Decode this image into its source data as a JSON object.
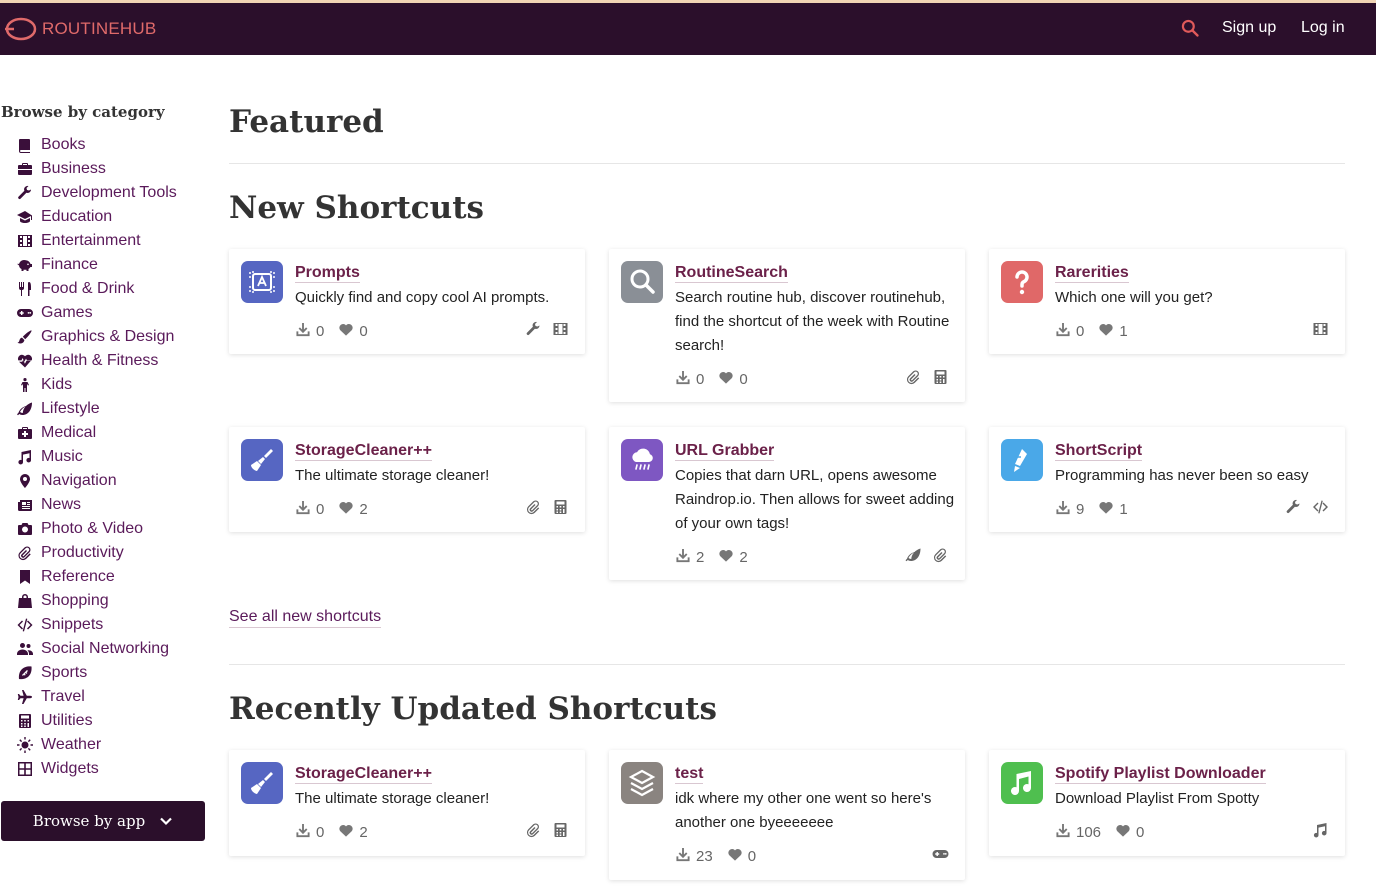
{
  "navbar": {
    "logo_text": "ROUTINEHUB",
    "signup": "Sign up",
    "login": "Log in"
  },
  "sidebar": {
    "title": "Browse by category",
    "categories": [
      "Books",
      "Business",
      "Development Tools",
      "Education",
      "Entertainment",
      "Finance",
      "Food & Drink",
      "Games",
      "Graphics & Design",
      "Health & Fitness",
      "Kids",
      "Lifestyle",
      "Medical",
      "Music",
      "Navigation",
      "News",
      "Photo & Video",
      "Productivity",
      "Reference",
      "Shopping",
      "Snippets",
      "Social Networking",
      "Sports",
      "Travel",
      "Utilities",
      "Weather",
      "Widgets"
    ],
    "browse_app": "Browse by app"
  },
  "featured": {
    "title": "Featured"
  },
  "new_shortcuts": {
    "title": "New Shortcuts",
    "see_all": "See all new shortcuts",
    "cards": [
      {
        "name": "Prompts",
        "desc": "Quickly find and copy cool AI prompts.",
        "downloads": "0",
        "hearts": "0",
        "icon_color": "#5666c2",
        "icon": "ai-prompt-icon",
        "cats": [
          "wrench-icon",
          "film-icon"
        ]
      },
      {
        "name": "RoutineSearch",
        "desc": "Search routine hub, discover routinehub, find the shortcut of the week with Routine search!",
        "downloads": "0",
        "hearts": "0",
        "icon_color": "#8a8f96",
        "icon": "magnifier-icon",
        "cats": [
          "paperclip-icon",
          "calculator-icon"
        ]
      },
      {
        "name": "Rarerities",
        "desc": "Which one will you get?",
        "downloads": "0",
        "hearts": "1",
        "icon_color": "#e06868",
        "icon": "question-mark-icon",
        "cats": [
          "film-icon"
        ]
      },
      {
        "name": "StorageCleaner++",
        "desc": "The ultimate storage cleaner!",
        "downloads": "0",
        "hearts": "2",
        "icon_color": "#5666c2",
        "icon": "broom-icon",
        "cats": [
          "paperclip-icon",
          "calculator-icon"
        ]
      },
      {
        "name": "URL Grabber",
        "desc": "Copies that darn URL, opens awesome Raindrop.io. Then allows for sweet adding of your own tags!",
        "downloads": "2",
        "hearts": "2",
        "icon_color": "#7e57c2",
        "icon": "rain-cloud-icon",
        "cats": [
          "leaf-icon",
          "paperclip-icon"
        ]
      },
      {
        "name": "ShortScript",
        "desc": "Programming has never been so easy",
        "downloads": "9",
        "hearts": "1",
        "icon_color": "#4aa8e8",
        "icon": "script-icon",
        "cats": [
          "wrench-icon",
          "code-icon"
        ]
      }
    ]
  },
  "recently_updated": {
    "title": "Recently Updated Shortcuts",
    "cards": [
      {
        "name": "StorageCleaner++",
        "desc": "The ultimate storage cleaner!",
        "downloads": "0",
        "hearts": "2",
        "icon_color": "#5666c2",
        "icon": "broom-icon",
        "cats": [
          "paperclip-icon",
          "calculator-icon"
        ]
      },
      {
        "name": "test",
        "desc": "idk where my other one went so here's another one byeeeeeee",
        "downloads": "23",
        "hearts": "0",
        "icon_color": "#8a8480",
        "icon": "shortcuts-icon",
        "cats": [
          "gamepad-icon"
        ]
      },
      {
        "name": "Spotify Playlist Downloader",
        "desc": "Download Playlist From Spotty",
        "downloads": "106",
        "hearts": "0",
        "icon_color": "#4fbf4f",
        "icon": "music-note-icon",
        "cats": [
          "music-icon"
        ]
      }
    ]
  }
}
